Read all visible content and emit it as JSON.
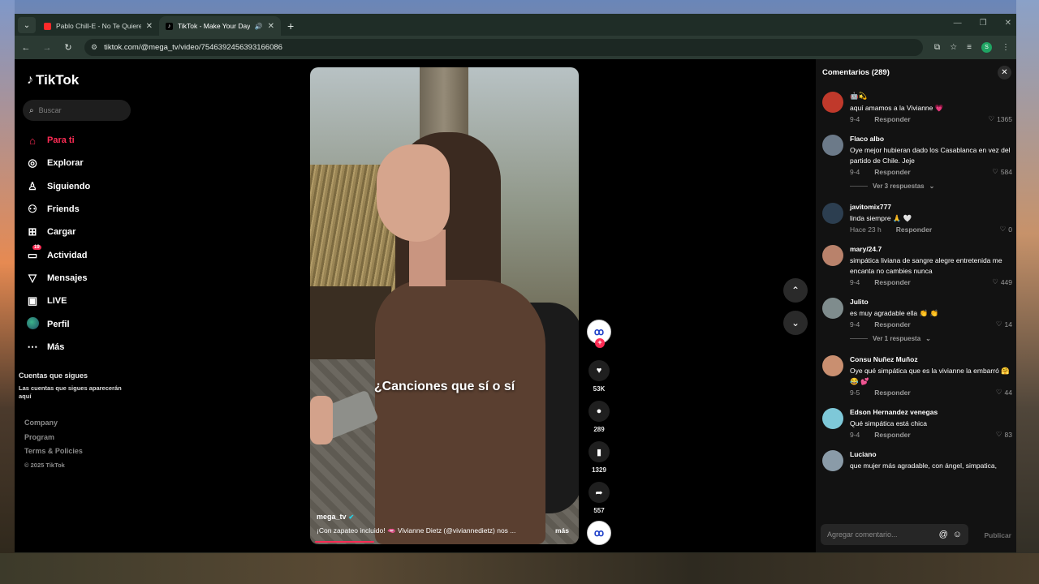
{
  "browser": {
    "tabs": [
      {
        "title": "Pablo Chill-E - No Te Quieren V",
        "favicon": "youtube-icon"
      },
      {
        "title": "TikTok - Make Your Day",
        "favicon": "tiktok-icon",
        "active": true
      }
    ],
    "url": "tiktok.com/@mega_tv/video/7546392456393166086",
    "profile_initial": "S"
  },
  "sidebar": {
    "logo": "TikTok",
    "search_placeholder": "Buscar",
    "items": [
      {
        "label": "Para ti",
        "icon": "home-icon",
        "active": true
      },
      {
        "label": "Explorar",
        "icon": "compass-icon"
      },
      {
        "label": "Siguiendo",
        "icon": "following-icon"
      },
      {
        "label": "Friends",
        "icon": "friends-icon"
      },
      {
        "label": "Cargar",
        "icon": "upload-icon"
      },
      {
        "label": "Actividad",
        "icon": "activity-icon",
        "badge": "19"
      },
      {
        "label": "Mensajes",
        "icon": "messages-icon"
      },
      {
        "label": "LIVE",
        "icon": "live-icon"
      },
      {
        "label": "Perfil",
        "icon": "profile-icon"
      },
      {
        "label": "Más",
        "icon": "more-icon"
      }
    ],
    "following_title": "Cuentas que sigues",
    "following_sub": "Las cuentas que sigues aparecerán aquí",
    "footer": [
      "Company",
      "Program",
      "Terms & Policies"
    ],
    "copyright": "© 2025 TikTok"
  },
  "video": {
    "caption": "¿Canciones que sí o sí",
    "username": "mega_tv",
    "description": "¡Con zapateo incluido! 🫦 Vivianne Dietz (@viviannedietz) nos ...",
    "more": "más",
    "progress": 0.22
  },
  "actions": {
    "likes": "53K",
    "comments": "289",
    "saves": "1329",
    "shares": "557"
  },
  "comments": {
    "header": "Comentarios (289)",
    "input_placeholder": "Agregar comentario...",
    "publish": "Publicar",
    "reply_label": "Responder",
    "items": [
      {
        "user": "🤖💫",
        "text": "aquí amamos a la Vivianne 💗",
        "date": "9-4",
        "likes": "1365",
        "avatar_color": "#c0392b"
      },
      {
        "user": "Flaco albo",
        "text": "Oye mejor hubieran dado los Casablanca en vez del partido de Chile. Jeje",
        "date": "9-4",
        "likes": "584",
        "avatar_color": "#6c7a89",
        "replies": "Ver 3 respuestas"
      },
      {
        "user": "javitomix777",
        "text": "linda siempre 🙏 🤍",
        "date": "Hace 23 h",
        "likes": "0",
        "avatar_color": "#2c3e50"
      },
      {
        "user": "mary/24.7",
        "text": "simpática liviana de sangre alegre entretenida me encanta no cambies nunca",
        "date": "9-4",
        "likes": "449",
        "avatar_color": "#b9826b"
      },
      {
        "user": "Julito",
        "text": "es muy agradable ella 👏 👏",
        "date": "9-4",
        "likes": "14",
        "avatar_color": "#7f8c8d",
        "replies": "Ver 1 respuesta"
      },
      {
        "user": "Consu Nuñez Muñoz",
        "text": "Oye qué simpática que es la vivianne la embarró 🤗 😂 💕",
        "date": "9-5",
        "likes": "44",
        "avatar_color": "#c98f70"
      },
      {
        "user": "Edson Hernandez venegas",
        "text": "Qué simpática está chica",
        "date": "9-4",
        "likes": "83",
        "avatar_color": "#7ec8d8"
      },
      {
        "user": "Luciano",
        "text": "que mujer más agradable, con ángel, simpatica,",
        "date": "",
        "likes": "",
        "avatar_color": "#8a9ba8"
      }
    ]
  }
}
